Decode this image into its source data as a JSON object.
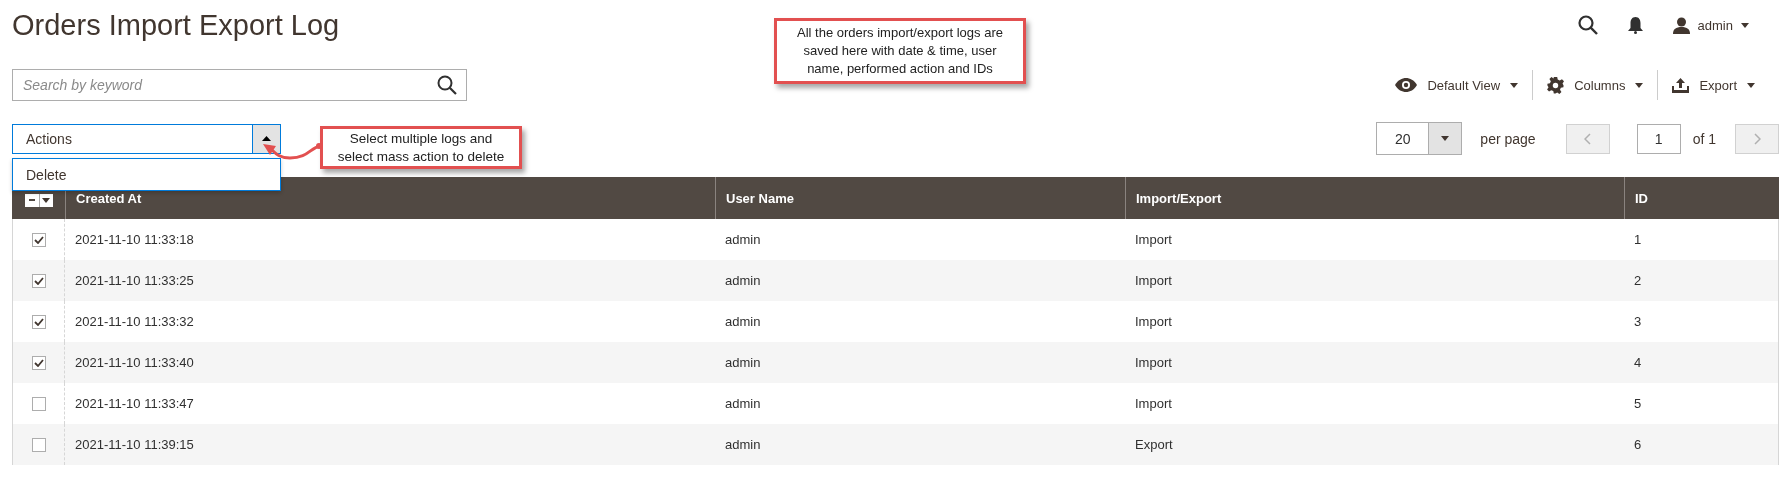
{
  "header": {
    "title": "Orders Import Export Log",
    "user": "admin"
  },
  "search": {
    "placeholder": "Search by keyword"
  },
  "toolbar": [
    {
      "kind": "view",
      "label": "Default View"
    },
    {
      "kind": "columns",
      "label": "Columns"
    },
    {
      "kind": "export",
      "label": "Export"
    }
  ],
  "actions": {
    "label": "Actions",
    "expanded": true,
    "options": [
      "Delete"
    ]
  },
  "pager": {
    "page_size": "20",
    "per_page_label": "per page",
    "page": "1",
    "of_label": "of 1"
  },
  "table": {
    "columns": [
      "Created At",
      "User Name",
      "Import/Export",
      "ID"
    ],
    "rows": [
      {
        "checked": true,
        "cells": [
          "2021-11-10 11:33:18",
          "admin",
          "Import",
          "1"
        ]
      },
      {
        "checked": true,
        "cells": [
          "2021-11-10 11:33:25",
          "admin",
          "Import",
          "2"
        ]
      },
      {
        "checked": true,
        "cells": [
          "2021-11-10 11:33:32",
          "admin",
          "Import",
          "3"
        ]
      },
      {
        "checked": true,
        "cells": [
          "2021-11-10 11:33:40",
          "admin",
          "Import",
          "4"
        ]
      },
      {
        "checked": false,
        "cells": [
          "2021-11-10 11:33:47",
          "admin",
          "Import",
          "5"
        ]
      },
      {
        "checked": false,
        "cells": [
          "2021-11-10 11:39:15",
          "admin",
          "Export",
          "6"
        ]
      }
    ]
  },
  "annotations": [
    {
      "kind": "top",
      "text": "All the orders import/export logs are saved here with date & time, user name, performed action and IDs"
    },
    {
      "kind": "actions",
      "text": "Select multiple logs and select mass action to delete"
    }
  ]
}
